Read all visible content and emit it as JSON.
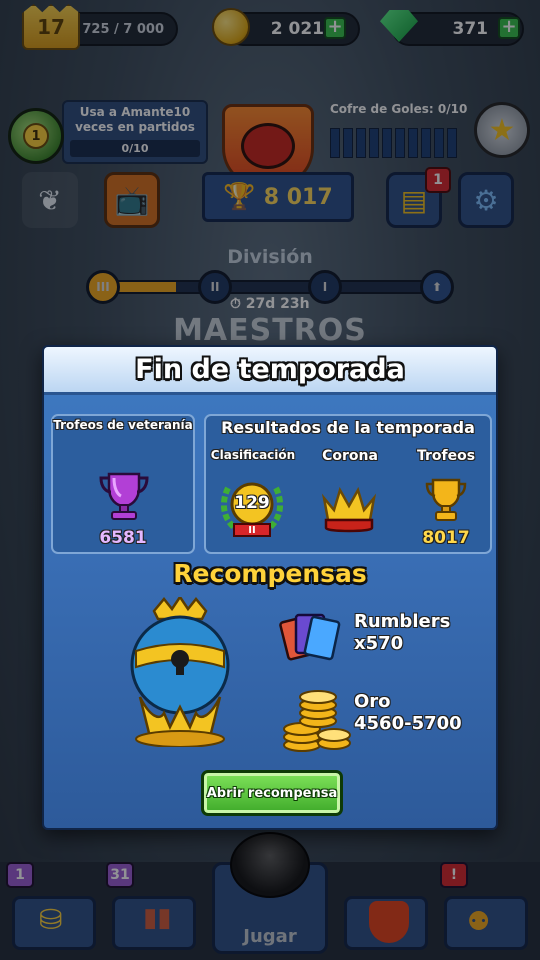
{
  "topbar": {
    "level": "17",
    "xp": "1 725 / 7 000",
    "coins": "2 021",
    "gems": "371",
    "plus": "+"
  },
  "hud": {
    "quest_badge": "1",
    "quest_text": "Usa a Amante10 veces en partidos",
    "quest_progress": "0/10",
    "chest_label": "Cofre de Goles: 0/10",
    "trophies": "8 017",
    "notif_count": "1",
    "division_label": "División",
    "division_nodes": [
      "III",
      "II",
      "I"
    ],
    "timer": "27d 23h",
    "league_name": "MAESTROS"
  },
  "modal": {
    "title": "Fin de temporada",
    "veteran": {
      "title": "Trofeos de veteranía",
      "value": "6581"
    },
    "season": {
      "title": "Resultados de la temporada",
      "rank_label": "Clasificación",
      "crown_label": "Corona",
      "trophies_label": "Trofeos",
      "rank_value": "129",
      "rank_tier": "II",
      "trophies_value": "8017"
    },
    "rewards_title": "Recompensas",
    "reward_cards": {
      "name": "Rumblers",
      "amount": "x570"
    },
    "reward_gold": {
      "name": "Oro",
      "amount": "4560-5700"
    },
    "open_button": "Abrir recompensa"
  },
  "bottom_nav": {
    "shop_badge": "1",
    "cards_badge": "31",
    "alert_badge": "!",
    "play_label": "Jugar"
  },
  "colors": {
    "modal_blue": "#3a6fb6",
    "gold": "#ffd23a",
    "green_button": "#3faa2a",
    "badge_red": "#d8262a"
  }
}
